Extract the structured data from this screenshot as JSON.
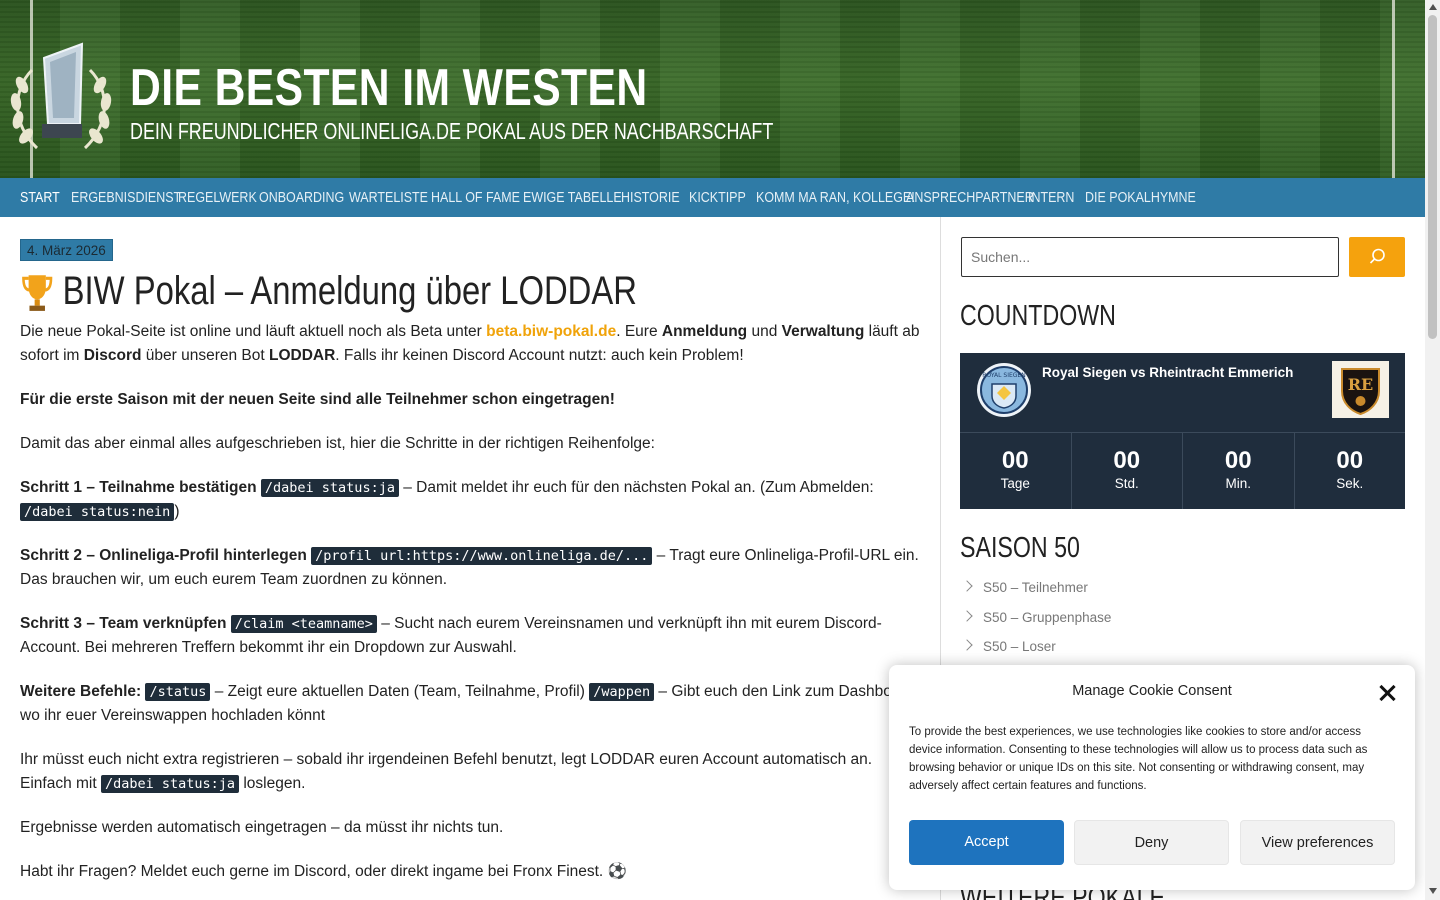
{
  "header": {
    "title": "DIE BESTEN IM WESTEN",
    "tagline": "DEIN FREUNDLICHER ONLINELIGA.DE POKAL AUS DER NACHBARSCHAFT"
  },
  "nav": {
    "items": [
      {
        "label": "START"
      },
      {
        "label": "ERGEBNISDIENST"
      },
      {
        "label": "REGELWERK"
      },
      {
        "label": "ONBOARDING"
      },
      {
        "label": "WARTELISTE"
      },
      {
        "label": "HALL OF FAME"
      },
      {
        "label": "EWIGE TABELLE"
      },
      {
        "label": "HISTORIE"
      },
      {
        "label": "KICKTIPP"
      },
      {
        "label": "KOMM MA RAN, KOLLEGE!"
      },
      {
        "label": "ANSPRECHPARTNER"
      },
      {
        "label": "INTERN"
      },
      {
        "label": "DIE POKALHYMNE"
      }
    ]
  },
  "post": {
    "date": "4. März 2026",
    "title": "BIW Pokal – Anmeldung über LODDAR",
    "p1": {
      "a": "Die neue Pokal-Seite ist online und läuft aktuell noch als Beta unter ",
      "link": "beta.biw-pokal.de",
      "b": ". Eure ",
      "bold1": "Anmeldung",
      "c": " und ",
      "bold2": "Verwaltung",
      "d": " läuft ab sofort im ",
      "bold3": "Discord",
      "e": " über unseren Bot ",
      "bold4": "LODDAR",
      "f": ". Falls ihr keinen Discord Account nutzt: auch kein Problem!"
    },
    "p2": "Für die erste Saison mit der neuen Seite sind alle Teilnehmer schon eingetragen!",
    "p3": "Damit das aber einmal alles aufgeschrieben ist, hier die Schritte in der richtigen Reihenfolge:",
    "step1": {
      "label": "Schritt 1 – Teilnahme bestätigen",
      "code1": "/dabei status:ja",
      "text": " – Damit meldet ihr euch für den nächsten Pokal an. (Zum Abmelden: ",
      "code2": "/dabei status:nein",
      "end": ")"
    },
    "step2": {
      "label": "Schritt 2 – Onlineliga-Profil hinterlegen",
      "code": "/profil url:https://www.onlineliga.de/...",
      "text": " – Tragt eure Onlineliga-Profil-URL ein. Das brauchen wir, um euch eurem Team zuordnen zu können."
    },
    "step3": {
      "label": "Schritt 3 – Team verknüpfen",
      "code": "/claim <teamname>",
      "text": " – Sucht nach eurem Vereinsnamen und verknüpft ihn mit eurem Discord-Account. Bei mehreren Treffern bekommt ihr ein Dropdown zur Auswahl."
    },
    "more": {
      "label": "Weitere Befehle:",
      "code1": "/status",
      "text1": " – Zeigt eure aktuellen Daten (Team, Teilnahme, Profil) ",
      "code2": "/wappen",
      "text2": " – Gibt euch den Link zum Dashboard, wo ihr euer Vereinswappen hochladen könnt"
    },
    "p4": {
      "a": "Ihr müsst euch nicht extra registrieren – sobald ihr irgendeinen Befehl benutzt, legt LODDAR euren Account automatisch an. Einfach mit ",
      "code": "/dabei status:ja",
      "b": " loslegen."
    },
    "p5": "Ergebnisse werden automatisch eingetragen – da müsst ihr nichts tun.",
    "p6": "Habt ihr Fragen? Meldet euch gerne im Discord, oder direkt ingame bei Fronx Finest. ⚽"
  },
  "sidebar": {
    "search_placeholder": "Suchen...",
    "countdown_title": "COUNTDOWN",
    "match": "Royal Siegen vs Rheintracht Emmerich",
    "countdown": [
      {
        "value": "00",
        "label": "Tage"
      },
      {
        "value": "00",
        "label": "Std."
      },
      {
        "value": "00",
        "label": "Min."
      },
      {
        "value": "00",
        "label": "Sek."
      }
    ],
    "saison_title": "SAISON 50",
    "saison_items": [
      {
        "label": "S50 – Teilnehmer"
      },
      {
        "label": "S50 – Gruppenphase"
      },
      {
        "label": "S50 – Loser"
      }
    ],
    "weitere_title": "WEITERE POKALE",
    "team_left_badge": "ROYAL SIEGEN",
    "team_right_badge": "RE"
  },
  "cookie": {
    "title": "Manage Cookie Consent",
    "text": "To provide the best experiences, we use technologies like cookies to store and/or access device information. Consenting to these technologies will allow us to process data such as browsing behavior or unique IDs on this site. Not consenting or withdrawing consent, may adversely affect certain features and functions.",
    "accept": "Accept",
    "deny": "Deny",
    "prefs": "View preferences"
  },
  "colors": {
    "nav_bg": "#2f7ba6",
    "accent_orange": "#f5a20d",
    "countdown_bg": "#1f2d3d",
    "accept_blue": "#1e73be"
  }
}
